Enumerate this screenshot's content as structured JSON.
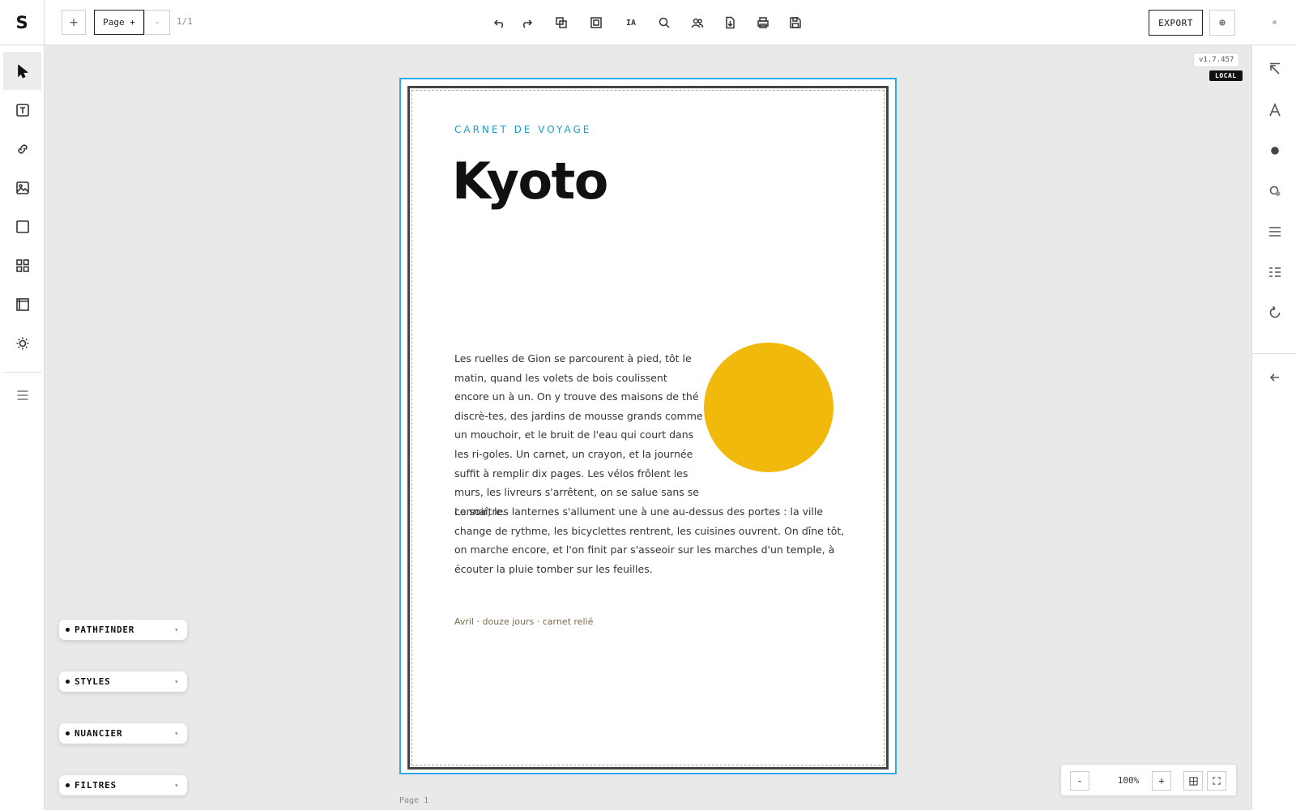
{
  "app": {
    "logo": "S"
  },
  "toolbar": {
    "add_label": "+",
    "page_label": "Page +",
    "minus_label": "-",
    "page_count": "1/1",
    "ia_label": "IA",
    "export_label": "EXPORT"
  },
  "version": {
    "number": "v1.7.457",
    "env": "LOCAL"
  },
  "document": {
    "kicker": "CARNET DE VOYAGE",
    "title": "Kyoto",
    "paragraph_1": "Les ruelles de Gion se parcourent à pied, tôt le matin, quand les volets de bois coulissent encore un à un. On y trouve des maisons de thé discrè-tes, des jardins de mousse grands comme un mouchoir, et le bruit de l'eau qui court dans les ri-goles. Un carnet, un crayon, et la journée suffit à remplir dix pages. Les vélos frôlent les murs, les livreurs s'arrêtent, on se salue sans se connaître.",
    "paragraph_2": "Le soir, les lanternes s'allument une à une au-dessus des portes : la ville change de rythme, les bicyclettes rentrent, les cuisines ouvrent. On dîne tôt, on marche encore, et l'on finit par s'asseoir sur les marches d'un temple, à écouter la pluie tomber sur les feuilles.",
    "footer_note": "Avril · douze jours · carnet relié",
    "accent_color": "#f1b90c",
    "kicker_color": "#1b9cc4"
  },
  "canvas": {
    "page_label": "Page 1",
    "selection_color": "#2ea8e6"
  },
  "panels": [
    {
      "label": "PATHFINDER"
    },
    {
      "label": "STYLES"
    },
    {
      "label": "NUANCIER"
    },
    {
      "label": "FILTRES"
    }
  ],
  "zoom": {
    "minus": "-",
    "value": "100%",
    "plus": "+"
  },
  "icons": {
    "top": [
      "undo-icon",
      "redo-icon",
      "duplicate-icon",
      "frame-select-icon",
      "ia-icon",
      "search-icon",
      "users-icon",
      "import-icon",
      "print-icon",
      "save-icon",
      "settings-icon"
    ],
    "left": [
      "select-icon",
      "text-icon",
      "link-icon",
      "image-icon",
      "rectangle-icon",
      "grid-icon",
      "frame-icon",
      "light-icon",
      "menu-icon"
    ],
    "right": [
      "collapse-icon",
      "typography-icon",
      "fill-dot-icon",
      "color-picker-icon",
      "align-icon",
      "list-icon",
      "rotate-icon",
      "back-arrow-icon"
    ]
  }
}
